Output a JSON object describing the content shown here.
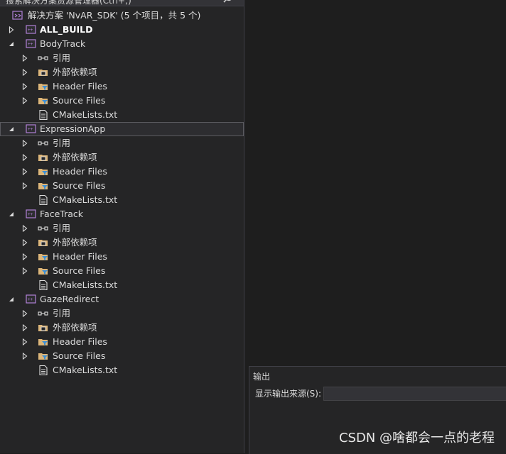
{
  "search": {
    "placeholder": "搜索解决方案资源管理器(Ctrl+;)"
  },
  "solution": {
    "label": "解决方案 'NvAR_SDK' (5 个项目，共 5 个)"
  },
  "tree": [
    {
      "label": "ALL_BUILD",
      "bold": true,
      "expanded": false,
      "children": []
    },
    {
      "label": "BodyTrack",
      "bold": false,
      "expanded": true,
      "children": [
        {
          "label": "引用",
          "icon": "references-icon",
          "expandable": true
        },
        {
          "label": "外部依赖项",
          "icon": "external-dependencies-icon",
          "expandable": true
        },
        {
          "label": "Header Files",
          "icon": "filter-folder-icon",
          "expandable": true
        },
        {
          "label": "Source Files",
          "icon": "filter-folder-icon",
          "expandable": true
        },
        {
          "label": "CMakeLists.txt",
          "icon": "text-file-icon",
          "expandable": false
        }
      ]
    },
    {
      "label": "ExpressionApp",
      "bold": false,
      "expanded": true,
      "selected": true,
      "children": [
        {
          "label": "引用",
          "icon": "references-icon",
          "expandable": true
        },
        {
          "label": "外部依赖项",
          "icon": "external-dependencies-icon",
          "expandable": true
        },
        {
          "label": "Header Files",
          "icon": "filter-folder-icon",
          "expandable": true
        },
        {
          "label": "Source Files",
          "icon": "filter-folder-icon",
          "expandable": true
        },
        {
          "label": "CMakeLists.txt",
          "icon": "text-file-icon",
          "expandable": false
        }
      ]
    },
    {
      "label": "FaceTrack",
      "bold": false,
      "expanded": true,
      "children": [
        {
          "label": "引用",
          "icon": "references-icon",
          "expandable": true
        },
        {
          "label": "外部依赖项",
          "icon": "external-dependencies-icon",
          "expandable": true
        },
        {
          "label": "Header Files",
          "icon": "filter-folder-icon",
          "expandable": true
        },
        {
          "label": "Source Files",
          "icon": "filter-folder-icon",
          "expandable": true
        },
        {
          "label": "CMakeLists.txt",
          "icon": "text-file-icon",
          "expandable": false
        }
      ]
    },
    {
      "label": "GazeRedirect",
      "bold": false,
      "expanded": true,
      "children": [
        {
          "label": "引用",
          "icon": "references-icon",
          "expandable": true
        },
        {
          "label": "外部依赖项",
          "icon": "external-dependencies-icon",
          "expandable": true
        },
        {
          "label": "Header Files",
          "icon": "filter-folder-icon",
          "expandable": true
        },
        {
          "label": "Source Files",
          "icon": "filter-folder-icon",
          "expandable": true
        },
        {
          "label": "CMakeLists.txt",
          "icon": "text-file-icon",
          "expandable": false
        }
      ]
    }
  ],
  "output": {
    "title": "输出",
    "source_label": "显示输出来源(S):",
    "source_value": ""
  },
  "watermark": "CSDN @啥都会一点的老程",
  "colors": {
    "background": "#1e1e1e",
    "panel": "#252526",
    "project_icon": "#b180d7",
    "folder": "#dcb67a",
    "filter": "#3c8fd6"
  }
}
